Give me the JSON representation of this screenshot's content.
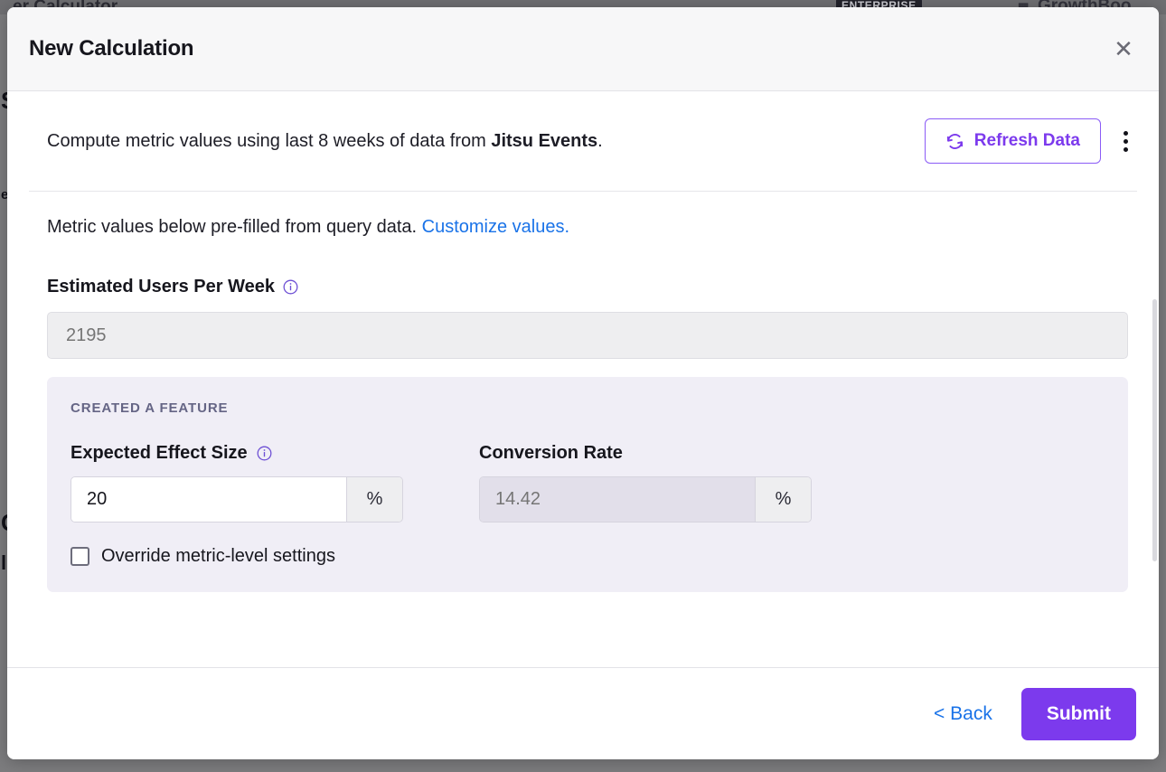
{
  "background": {
    "app_title": "er Calculator",
    "badge": "ENTERPRISE",
    "brand": "GrowthBoo",
    "brand_icon": "grid-icon",
    "left_glyphs": [
      "S",
      "e",
      "C",
      "l"
    ]
  },
  "modal": {
    "title": "New Calculation",
    "close_icon": "close-icon",
    "compute": {
      "text_before": "Compute metric values using last 8 weeks of data from ",
      "source": "Jitsu Events",
      "text_after": ".",
      "refresh_label": "Refresh Data",
      "refresh_icon": "refresh-icon",
      "kebab_icon": "more-vertical-icon"
    },
    "prefilled": {
      "text": "Metric values below pre-filled from query data. ",
      "link": "Customize values."
    },
    "users_field": {
      "label": "Estimated Users Per Week",
      "info_icon": "info-icon",
      "value": "2195",
      "placeholder": "2195",
      "disabled": true
    },
    "metric_card": {
      "kicker": "CREATED A FEATURE",
      "effect": {
        "label": "Expected Effect Size",
        "info_icon": "info-icon",
        "value": "20",
        "suffix": "%"
      },
      "conversion": {
        "label": "Conversion Rate",
        "value": "14.42",
        "placeholder": "14.42",
        "suffix": "%",
        "disabled": true
      },
      "override": {
        "label": "Override metric-level settings",
        "checked": false
      }
    },
    "footer": {
      "back_label": "< Back",
      "submit_label": "Submit"
    }
  },
  "colors": {
    "accent_purple": "#7c3aed",
    "link_blue": "#1a73e8",
    "card_bg": "#f0eef6",
    "header_bg": "#f7f7f8",
    "backdrop": "#7c7c7e"
  }
}
